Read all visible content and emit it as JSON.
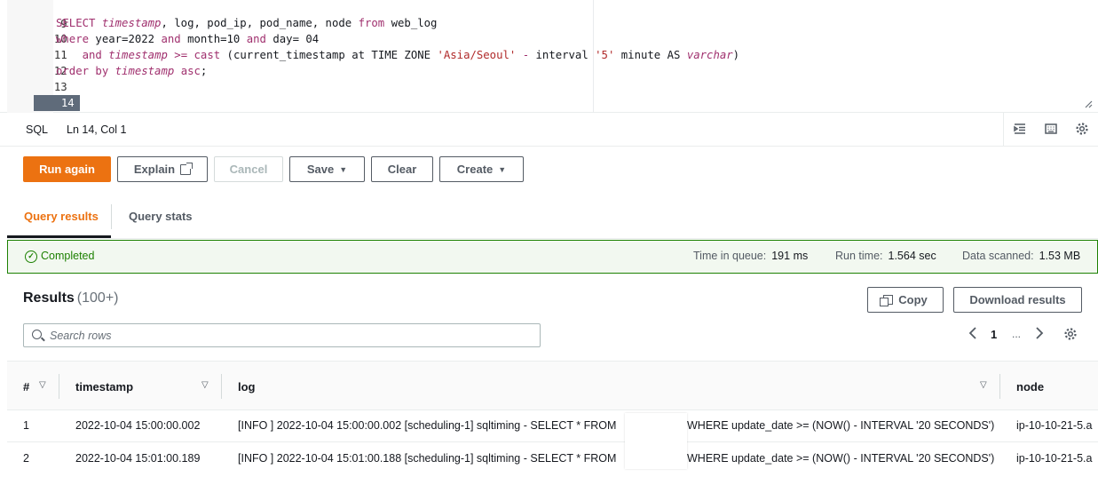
{
  "editor": {
    "lines": [
      {
        "num": "9",
        "text": ""
      },
      {
        "num": "10"
      },
      {
        "num": "11"
      },
      {
        "num": "12"
      },
      {
        "num": "13"
      },
      {
        "num": "14",
        "text": ""
      }
    ],
    "tokens": {
      "l10_select": "SELECT ",
      "l10_ts": "timestamp",
      "l10_cols": ", log, pod_ip, pod_name, node ",
      "l10_from": "from",
      "l10_table": " web_log",
      "l11_where": "where",
      "l11_cond1": " year=2022 ",
      "l11_and1": "and",
      "l11_cond2": " month=10 ",
      "l11_and2": "and",
      "l11_cond3": " day= 04",
      "l12_indent": "    ",
      "l12_and": "and",
      "l12_ts": "timestamp",
      "l12_ge": " >= ",
      "l12_cast": "cast",
      "l12_mid": " (current_timestamp at TIME ZONE ",
      "l12_tz": "'Asia/Seoul'",
      "l12_minus": " - ",
      "l12_interval": "interval",
      "l12_sp": " ",
      "l12_five": "'5'",
      "l12_minute": " minute ",
      "l12_as": "AS",
      "l12_sp2": " ",
      "l12_varchar": "varchar",
      "l12_close": ")",
      "l13_order": "order by",
      "l13_sp": " ",
      "l13_ts": "timestamp",
      "l13_sp2": " ",
      "l13_asc": "asc",
      "l13_end": ";"
    }
  },
  "status_bar": {
    "language": "SQL",
    "cursor": "Ln 14, Col 1"
  },
  "actions": {
    "run_again": "Run again",
    "explain": "Explain",
    "cancel": "Cancel",
    "save": "Save",
    "clear": "Clear",
    "create": "Create"
  },
  "tabs": [
    {
      "label": "Query results",
      "active": true
    },
    {
      "label": "Query stats",
      "active": false
    }
  ],
  "banner": {
    "status": "Completed",
    "queue_label": "Time in queue:",
    "queue_value": "191 ms",
    "run_label": "Run time:",
    "run_value": "1.564 sec",
    "scanned_label": "Data scanned:",
    "scanned_value": "1.53 MB"
  },
  "results": {
    "title": "Results",
    "count": "(100+)",
    "copy_label": "Copy",
    "download_label": "Download results",
    "search_placeholder": "Search rows",
    "page": "1",
    "ellipsis": "..."
  },
  "table": {
    "columns": [
      "#",
      "timestamp",
      "log",
      "node"
    ],
    "rows": [
      {
        "num": "1",
        "timestamp": "2022-10-04 15:00:00.002",
        "log_a": "[INFO ] 2022-10-04 15:00:00.002 [scheduling-1] sqltiming - SELECT * FROM",
        "log_b": "WHERE update_date >= (NOW() - INTERVAL '20 SECONDS')",
        "node": "ip-10-10-21-5.a"
      },
      {
        "num": "2",
        "timestamp": "2022-10-04 15:01:00.189",
        "log_a": "[INFO ] 2022-10-04 15:01:00.188 [scheduling-1] sqltiming - SELECT * FROM",
        "log_b": "WHERE update_date >= (NOW() - INTERVAL '20 SECONDS')",
        "node": "ip-10-10-21-5.a"
      }
    ]
  },
  "colors": {
    "accent": "#ec7211",
    "success": "#1d8102",
    "text": "#16191f"
  },
  "icons": [
    "external-link-icon",
    "caret-down-icon",
    "check-circle-icon",
    "copy-icon",
    "search-icon",
    "chevron-left-icon",
    "chevron-right-icon",
    "gear-icon",
    "indent-icon",
    "keyboard-icon"
  ]
}
